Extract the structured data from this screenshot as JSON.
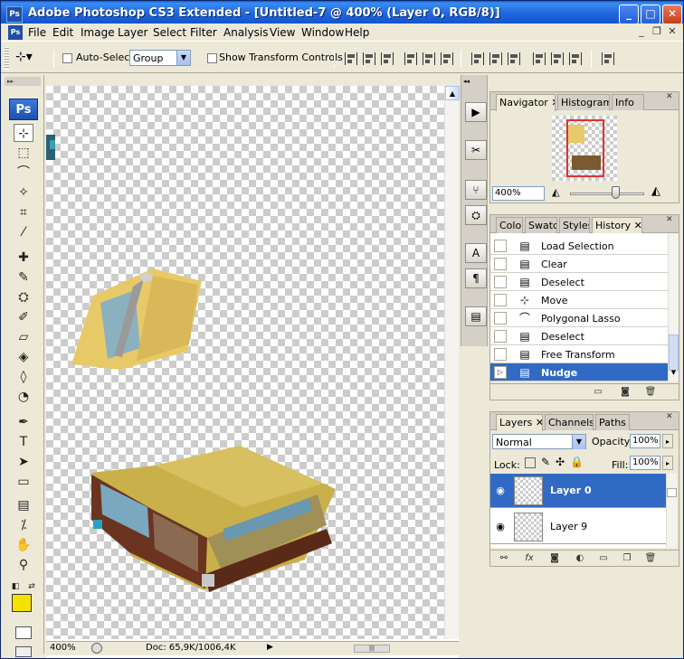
{
  "window": {
    "title": "Adobe Photoshop CS3 Extended - [Untitled-7 @ 400% (Layer 0, RGB/8)]",
    "app_icon": "Ps"
  },
  "menu": [
    "File",
    "Edit",
    "Image",
    "Layer",
    "Select",
    "Filter",
    "Analysis",
    "View",
    "Window",
    "Help"
  ],
  "options": {
    "auto_select_label": "Auto-Select:",
    "auto_select_value": "Group",
    "show_transform_label": "Show Transform Controls"
  },
  "toolbox": {
    "logo": "Ps"
  },
  "status": {
    "zoom": "400%",
    "doc": "Doc: 65,9K/1006,4K"
  },
  "navigator": {
    "tabs": [
      "Navigator",
      "Histogram",
      "Info"
    ],
    "zoom": "400%"
  },
  "history": {
    "tabs": [
      "Color",
      "Swatches",
      "Styles",
      "History"
    ],
    "items": [
      {
        "label": "Load Selection",
        "icon": "document-icon"
      },
      {
        "label": "Clear",
        "icon": "document-icon"
      },
      {
        "label": "Deselect",
        "icon": "document-icon"
      },
      {
        "label": "Move",
        "icon": "move-icon"
      },
      {
        "label": "Polygonal Lasso",
        "icon": "lasso-icon"
      },
      {
        "label": "Deselect",
        "icon": "document-icon"
      },
      {
        "label": "Free Transform",
        "icon": "document-icon"
      },
      {
        "label": "Nudge",
        "icon": "document-icon",
        "selected": true
      }
    ]
  },
  "layers": {
    "tabs": [
      "Layers",
      "Channels",
      "Paths"
    ],
    "blend_mode": "Normal",
    "opacity_label": "Opacity:",
    "opacity": "100%",
    "lock_label": "Lock:",
    "fill_label": "Fill:",
    "fill": "100%",
    "items": [
      {
        "name": "Layer 0",
        "selected": true
      },
      {
        "name": "Layer 9",
        "selected": false
      }
    ]
  },
  "colors": {
    "foreground": "#f4e200",
    "background": "#ffffff",
    "selection": "#316ac5",
    "titlebar": "#2168dd"
  }
}
